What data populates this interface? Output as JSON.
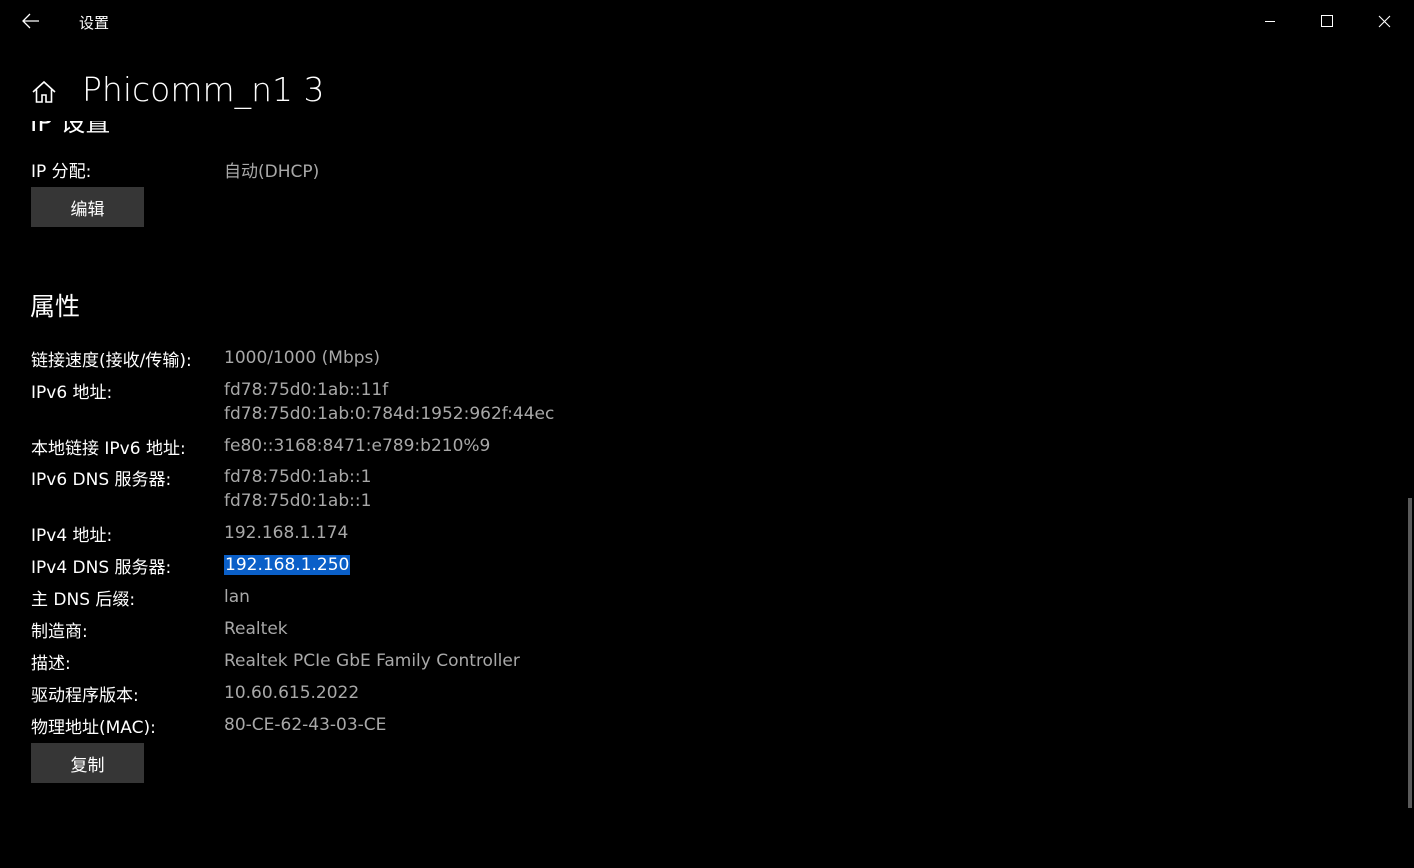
{
  "window": {
    "app_title": "设置",
    "back_icon": "arrow-left-icon",
    "minimize_icon": "minimize-icon",
    "maximize_icon": "maximize-icon",
    "close_icon": "close-icon"
  },
  "header": {
    "home_icon": "home-icon",
    "title": "Phicomm_n1 3"
  },
  "ip_settings": {
    "heading_partial": "IP 设置",
    "assignment_label": "IP 分配:",
    "assignment_value": "自动(DHCP)",
    "edit_button": "编辑"
  },
  "properties": {
    "heading": "属性",
    "rows": [
      {
        "label": "链接速度(接收/传输):",
        "values": [
          "1000/1000 (Mbps)"
        ]
      },
      {
        "label": "IPv6 地址:",
        "values": [
          "fd78:75d0:1ab::11f",
          "fd78:75d0:1ab:0:784d:1952:962f:44ec"
        ]
      },
      {
        "label": "本地链接 IPv6 地址:",
        "values": [
          "fe80::3168:8471:e789:b210%9"
        ]
      },
      {
        "label": "IPv6 DNS 服务器:",
        "values": [
          "fd78:75d0:1ab::1",
          "fd78:75d0:1ab::1"
        ]
      },
      {
        "label": "IPv4 地址:",
        "values": [
          "192.168.1.174"
        ]
      },
      {
        "label": "IPv4 DNS 服务器:",
        "values": [
          "192.168.1.250"
        ],
        "selected": true
      },
      {
        "label": "主 DNS 后缀:",
        "values": [
          "lan"
        ]
      },
      {
        "label": "制造商:",
        "values": [
          "Realtek"
        ]
      },
      {
        "label": "描述:",
        "values": [
          "Realtek PCIe GbE Family Controller"
        ]
      },
      {
        "label": "驱动程序版本:",
        "values": [
          "10.60.615.2022"
        ]
      },
      {
        "label": "物理地址(MAC):",
        "values": [
          "80-CE-62-43-03-CE"
        ]
      }
    ],
    "copy_button": "复制"
  },
  "colors": {
    "background": "#000000",
    "value_text": "#a8a8a8",
    "button_bg": "#363636",
    "selection": "#0a5fc8"
  }
}
